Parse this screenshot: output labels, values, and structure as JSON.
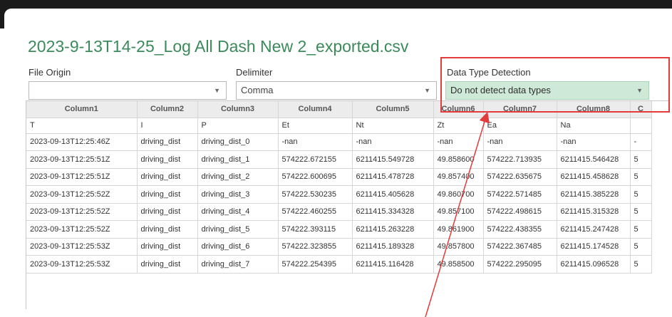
{
  "dialog": {
    "title": "2023-9-13T14-25_Log All Dash New 2_exported.csv"
  },
  "controls": {
    "file_origin": {
      "label": "File Origin",
      "value": ""
    },
    "delimiter": {
      "label": "Delimiter",
      "value": "Comma"
    },
    "data_type_detection": {
      "label": "Data Type Detection",
      "value": "Do not detect data types"
    }
  },
  "table": {
    "columns": [
      "Column1",
      "Column2",
      "Column3",
      "Column4",
      "Column5",
      "Column6",
      "Column7",
      "Column8",
      "C"
    ],
    "rows": [
      [
        "T",
        "I",
        "P",
        "Et",
        "Nt",
        "Zt",
        "Ea",
        "Na",
        ""
      ],
      [
        "2023-09-13T12:25:46Z",
        "driving_dist",
        "driving_dist_0",
        "-nan",
        "-nan",
        "-nan",
        "-nan",
        "-nan",
        "-"
      ],
      [
        "2023-09-13T12:25:51Z",
        "driving_dist",
        "driving_dist_1",
        "574222.672155",
        "6211415.549728",
        "49.858600",
        "574222.713935",
        "6211415.546428",
        "5"
      ],
      [
        "2023-09-13T12:25:51Z",
        "driving_dist",
        "driving_dist_2",
        "574222.600695",
        "6211415.478728",
        "49.857400",
        "574222.635675",
        "6211415.458628",
        "5"
      ],
      [
        "2023-09-13T12:25:52Z",
        "driving_dist",
        "driving_dist_3",
        "574222.530235",
        "6211415.405628",
        "49.860700",
        "574222.571485",
        "6211415.385228",
        "5"
      ],
      [
        "2023-09-13T12:25:52Z",
        "driving_dist",
        "driving_dist_4",
        "574222.460255",
        "6211415.334328",
        "49.857100",
        "574222.498615",
        "6211415.315328",
        "5"
      ],
      [
        "2023-09-13T12:25:52Z",
        "driving_dist",
        "driving_dist_5",
        "574222.393115",
        "6211415.263228",
        "49.861900",
        "574222.438355",
        "6211415.247428",
        "5"
      ],
      [
        "2023-09-13T12:25:53Z",
        "driving_dist",
        "driving_dist_6",
        "574222.323855",
        "6211415.189328",
        "49.857800",
        "574222.367485",
        "6211415.174528",
        "5"
      ],
      [
        "2023-09-13T12:25:53Z",
        "driving_dist",
        "driving_dist_7",
        "574222.254395",
        "6211415.116428",
        "49.858500",
        "574222.295095",
        "6211415.096528",
        "5"
      ]
    ]
  },
  "colors": {
    "title": "#3b8a5a",
    "detection_fill": "#cfe9d9",
    "annotation": "#e33c3c"
  },
  "icons": {
    "dropdown": "chevron-down-icon"
  }
}
